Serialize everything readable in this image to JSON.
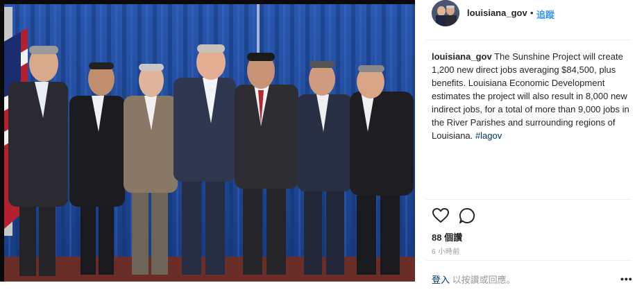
{
  "post": {
    "username": "louisiana_gov",
    "separator": "•",
    "follow_label": "追蹤",
    "caption_user": "louisiana_gov",
    "caption_text": "The Sunshine Project will create 1,200 new direct jobs averaging $84,500, plus benefits. Louisiana Economic Development estimates the project will also result in 8,000 new indirect jobs, for a total of more than 9,000 jobs in the River Parishes and surrounding regions of Louisiana.",
    "hashtag": "#lagov",
    "likes": "88 個讚",
    "timestamp": "6 小時前",
    "comment_login": "登入",
    "comment_prompt": "以按讚或回應。",
    "more_label": "•••"
  },
  "icons": [
    "heart-icon",
    "comment-icon",
    "more-options-icon"
  ],
  "colors": {
    "link_blue": "#3897f0",
    "hashtag_blue": "#003569",
    "curtain_blue": "#1e4a9a",
    "divider": "#efefef"
  }
}
